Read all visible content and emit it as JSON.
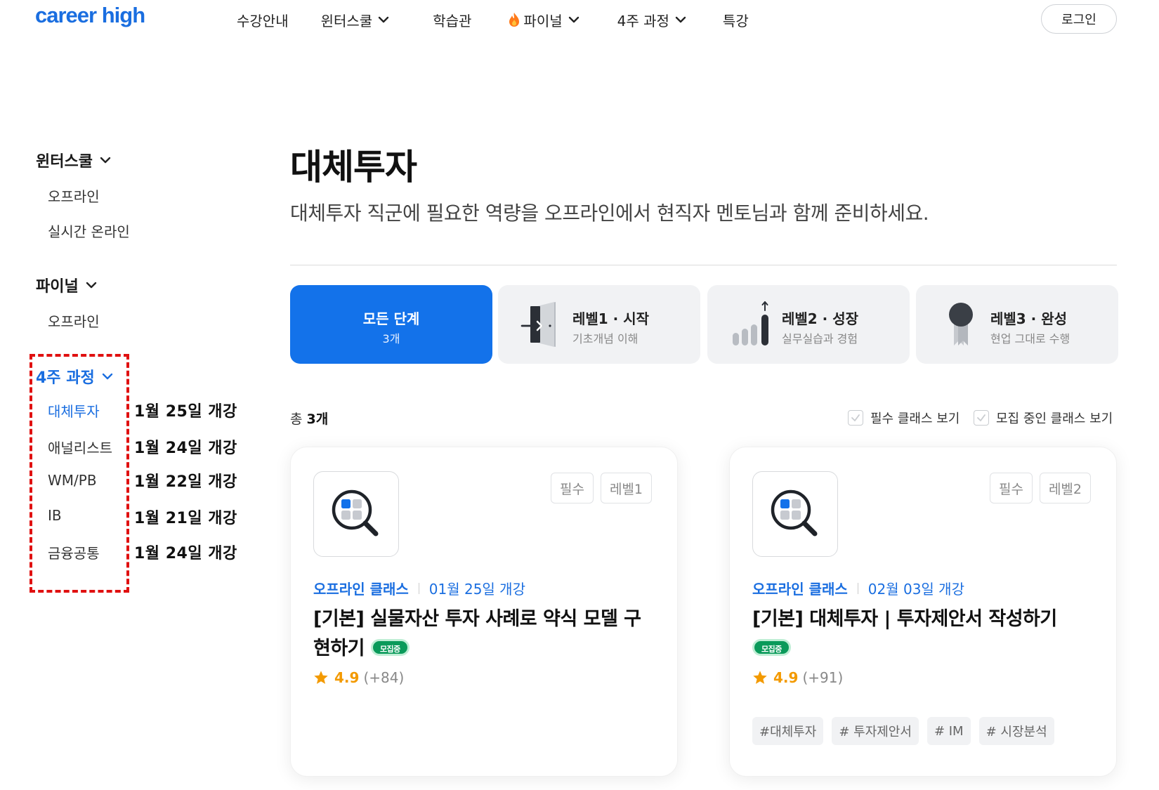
{
  "header": {
    "logo": "career high",
    "nav": [
      {
        "label": "수강안내",
        "has_dropdown": false,
        "icon": null
      },
      {
        "label": "윈터스쿨",
        "has_dropdown": true,
        "icon": null
      },
      {
        "label": "학습관",
        "has_dropdown": false,
        "icon": null
      },
      {
        "label": "파이널",
        "has_dropdown": true,
        "icon": "flame-icon"
      },
      {
        "label": "4주 과정",
        "has_dropdown": true,
        "icon": null
      },
      {
        "label": "특강",
        "has_dropdown": false,
        "icon": null
      }
    ],
    "login_label": "로그인"
  },
  "sidebar": {
    "groups": [
      {
        "label": "윈터스쿨",
        "active": false,
        "items": [
          {
            "label": "오프라인",
            "active": false
          },
          {
            "label": "실시간 온라인",
            "active": false
          }
        ]
      },
      {
        "label": "파이널",
        "active": false,
        "items": [
          {
            "label": "오프라인",
            "active": false
          }
        ]
      },
      {
        "label": "4주 과정",
        "active": true,
        "items": [
          {
            "label": "대체투자",
            "active": true
          },
          {
            "label": "애널리스트",
            "active": false
          },
          {
            "label": "WM/PB",
            "active": false
          },
          {
            "label": "IB",
            "active": false
          },
          {
            "label": "금융공통",
            "active": false
          }
        ]
      }
    ],
    "annotations": [
      "1월 25일 개강",
      "1월 24일 개강",
      "1월 22일 개강",
      "1월 21일 개강",
      "1월 24일 개강"
    ]
  },
  "main": {
    "title": "대체투자",
    "description": "대체투자 직군에 필요한 역량을 오프라인에서 현직자 멘토님과 함께 준비하세요.",
    "level_tabs": [
      {
        "title": "모든 단계",
        "sub": "3개",
        "active": true,
        "icon": null
      },
      {
        "title": "레벨1 · 시작",
        "sub": "기초개념 이해",
        "active": false,
        "icon": "door-enter-icon"
      },
      {
        "title": "레벨2 · 성장",
        "sub": "실무실습과 경험",
        "active": false,
        "icon": "growth-bars-icon"
      },
      {
        "title": "레벨3 · 완성",
        "sub": "현업 그대로 수행",
        "active": false,
        "icon": "medal-icon"
      }
    ],
    "total_prefix": "총",
    "total_count": "3개",
    "filters": [
      {
        "label": "필수 클래스 보기"
      },
      {
        "label": "모집 중인 클래스 보기"
      }
    ],
    "cards": [
      {
        "tags": [
          "필수",
          "레벨1"
        ],
        "type": "오프라인 클래스",
        "date": "01월 25일 개강",
        "title": "[기본] 실물자산 투자 사례로 약식 모델 구현하기",
        "badge": "모집중",
        "rating": "4.9",
        "rating_count": "(+84)",
        "hashtags": []
      },
      {
        "tags": [
          "필수",
          "레벨2"
        ],
        "type": "오프라인 클래스",
        "date": "02월 03일 개강",
        "title": "[기본] 대체투자 | 투자제안서 작성하기",
        "badge": "모집중",
        "rating": "4.9",
        "rating_count": "(+91)",
        "hashtags": [
          "#대체투자",
          "# 투자제안서",
          "# IM",
          "# 시장분석"
        ]
      }
    ]
  },
  "colors": {
    "brand": "#1a6ee0",
    "active_tab": "#1372ea",
    "badge": "#0a9a5a",
    "star": "#f39a00",
    "annotation_border": "#e01010"
  }
}
